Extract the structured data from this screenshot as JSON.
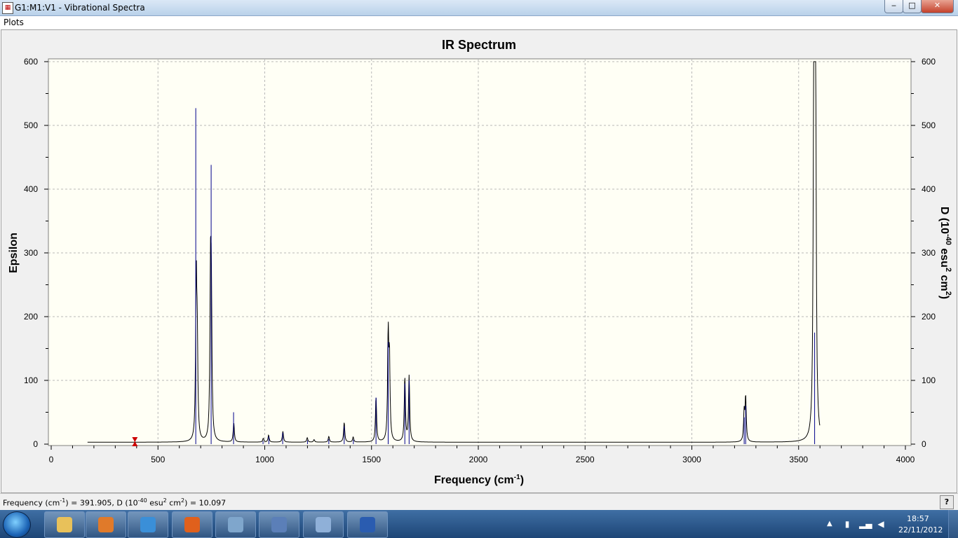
{
  "window": {
    "title": "G1:M1:V1 - Vibrational Spectra",
    "app_icon": "doc-icon"
  },
  "menubar": {
    "items": [
      "Plots"
    ]
  },
  "chart_data": {
    "type": "line",
    "title": "IR Spectrum",
    "xlabel": "Frequency (cm",
    "xlabel_sup": "-1",
    "xlabel_tail": ")",
    "ylabel": "Epsilon",
    "y2label_parts": [
      "D (10",
      "-40",
      " esu",
      "2",
      " cm",
      "2",
      ")"
    ],
    "xlim": [
      0,
      4000
    ],
    "ylim": [
      0,
      600
    ],
    "y2lim": [
      0,
      600
    ],
    "xticks": [
      "0",
      "500",
      "1000",
      "1500",
      "2000",
      "2500",
      "3000",
      "3500",
      "4000"
    ],
    "yticks": [
      "0",
      "100",
      "200",
      "300",
      "400",
      "500",
      "600"
    ],
    "y2ticks": [
      "0",
      "100",
      "200",
      "300",
      "400",
      "500",
      "600"
    ],
    "grid": true,
    "background": "#fffff5",
    "series": [
      {
        "color": "#000000",
        "style": "lorentzian-sum",
        "baseline": 3,
        "peaks": [
          {
            "x": 679,
            "y": 252
          },
          {
            "x": 684,
            "y": 140
          },
          {
            "x": 746,
            "y": 242
          },
          {
            "x": 750,
            "y": 200
          },
          {
            "x": 855,
            "y": 30
          },
          {
            "x": 993,
            "y": 6
          },
          {
            "x": 1018,
            "y": 11
          },
          {
            "x": 1085,
            "y": 17
          },
          {
            "x": 1199,
            "y": 7
          },
          {
            "x": 1231,
            "y": 4
          },
          {
            "x": 1300,
            "y": 9
          },
          {
            "x": 1372,
            "y": 31
          },
          {
            "x": 1414,
            "y": 8
          },
          {
            "x": 1521,
            "y": 70
          },
          {
            "x": 1578,
            "y": 162
          },
          {
            "x": 1584,
            "y": 120
          },
          {
            "x": 1656,
            "y": 100
          },
          {
            "x": 1676,
            "y": 103
          },
          {
            "x": 3245,
            "y": 45
          },
          {
            "x": 3252,
            "y": 68
          },
          {
            "x": 3571,
            "y": 450
          },
          {
            "x": 3575,
            "y": 535
          },
          {
            "x": 3580,
            "y": 410
          }
        ]
      },
      {
        "color": "#00008b",
        "style": "sticks",
        "sticks": [
          {
            "x": 677,
            "y": 527
          },
          {
            "x": 749,
            "y": 438
          },
          {
            "x": 854,
            "y": 50
          },
          {
            "x": 992,
            "y": 5
          },
          {
            "x": 1019,
            "y": 12
          },
          {
            "x": 1084,
            "y": 18
          },
          {
            "x": 1200,
            "y": 6
          },
          {
            "x": 1300,
            "y": 8
          },
          {
            "x": 1372,
            "y": 28
          },
          {
            "x": 1415,
            "y": 7
          },
          {
            "x": 1521,
            "y": 73
          },
          {
            "x": 1578,
            "y": 160
          },
          {
            "x": 1656,
            "y": 95
          },
          {
            "x": 1676,
            "y": 100
          },
          {
            "x": 3245,
            "y": 42
          },
          {
            "x": 3252,
            "y": 60
          },
          {
            "x": 3575,
            "y": 175
          }
        ]
      }
    ],
    "marker": {
      "x": 391.905,
      "color": "#cc0000"
    }
  },
  "statusbar": {
    "parts": [
      "Frequency (cm",
      "-1",
      ") = 391.905, D (10",
      "-40",
      " esu",
      "2",
      " cm",
      "2",
      ") = 10.097"
    ],
    "help_label": "?"
  },
  "taskbar": {
    "apps": [
      "folder-icon",
      "media-player-icon",
      "internet-explorer-icon",
      "firefox-icon",
      "magnifier-icon",
      "document-icon",
      "paint-icon",
      "word-icon"
    ],
    "clock_time": "18:57",
    "clock_date": "22/11/2012"
  },
  "colors": {
    "titlebar": "#c6daf0",
    "taskbar": "#2a5a92",
    "plot_background": "#fffff5",
    "grid": "#b0b0b0"
  }
}
